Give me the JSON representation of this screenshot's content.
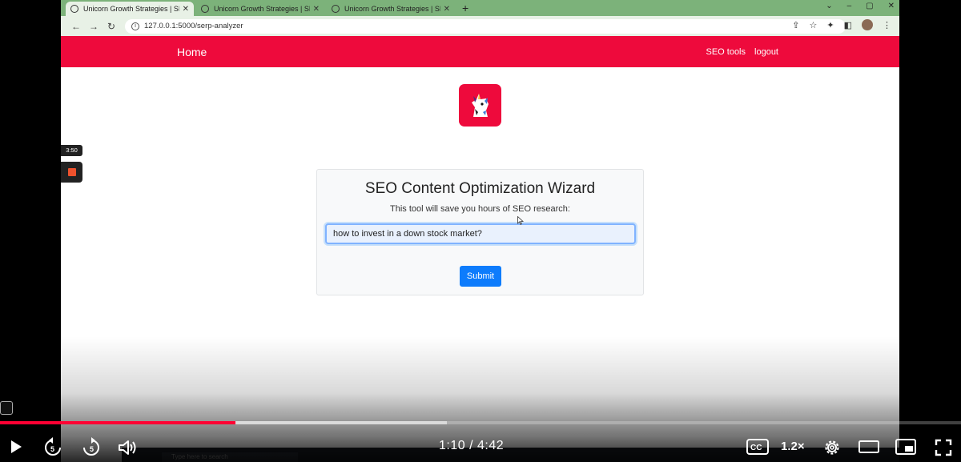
{
  "browser": {
    "tabs": [
      {
        "label": "Unicorn Growth Strategies | SEO",
        "active": true
      },
      {
        "label": "Unicorn Growth Strategies | SEO",
        "active": false
      },
      {
        "label": "Unicorn Growth Strategies | SEO",
        "active": false
      }
    ],
    "url": "127.0.0.1:5000/serp-analyzer"
  },
  "site": {
    "brand": "Home",
    "nav_links": [
      "SEO tools",
      "logout"
    ],
    "accent": "#ee0a3c"
  },
  "wizard": {
    "title": "SEO Content Optimization Wizard",
    "subtitle": "This tool will save you hours of SEO research:",
    "query_value": "how to invest in a down stock market?",
    "submit_label": "Submit",
    "submit_color": "#0d7cfc"
  },
  "recorder": {
    "elapsed": "3:50"
  },
  "taskbar": {
    "search_placeholder": "Type here to search"
  },
  "player": {
    "current_time": "1:10",
    "separator": "/",
    "duration": "4:42",
    "played_fraction": 0.245,
    "buffered_fraction": 0.465,
    "speed_label": "1.2×",
    "progress_color": "#ff0033",
    "icons": [
      "play-icon",
      "rewind-5-icon",
      "forward-5-icon",
      "volume-icon",
      "captions-icon",
      "settings-icon",
      "theater-icon",
      "miniplayer-icon",
      "fullscreen-icon"
    ]
  }
}
